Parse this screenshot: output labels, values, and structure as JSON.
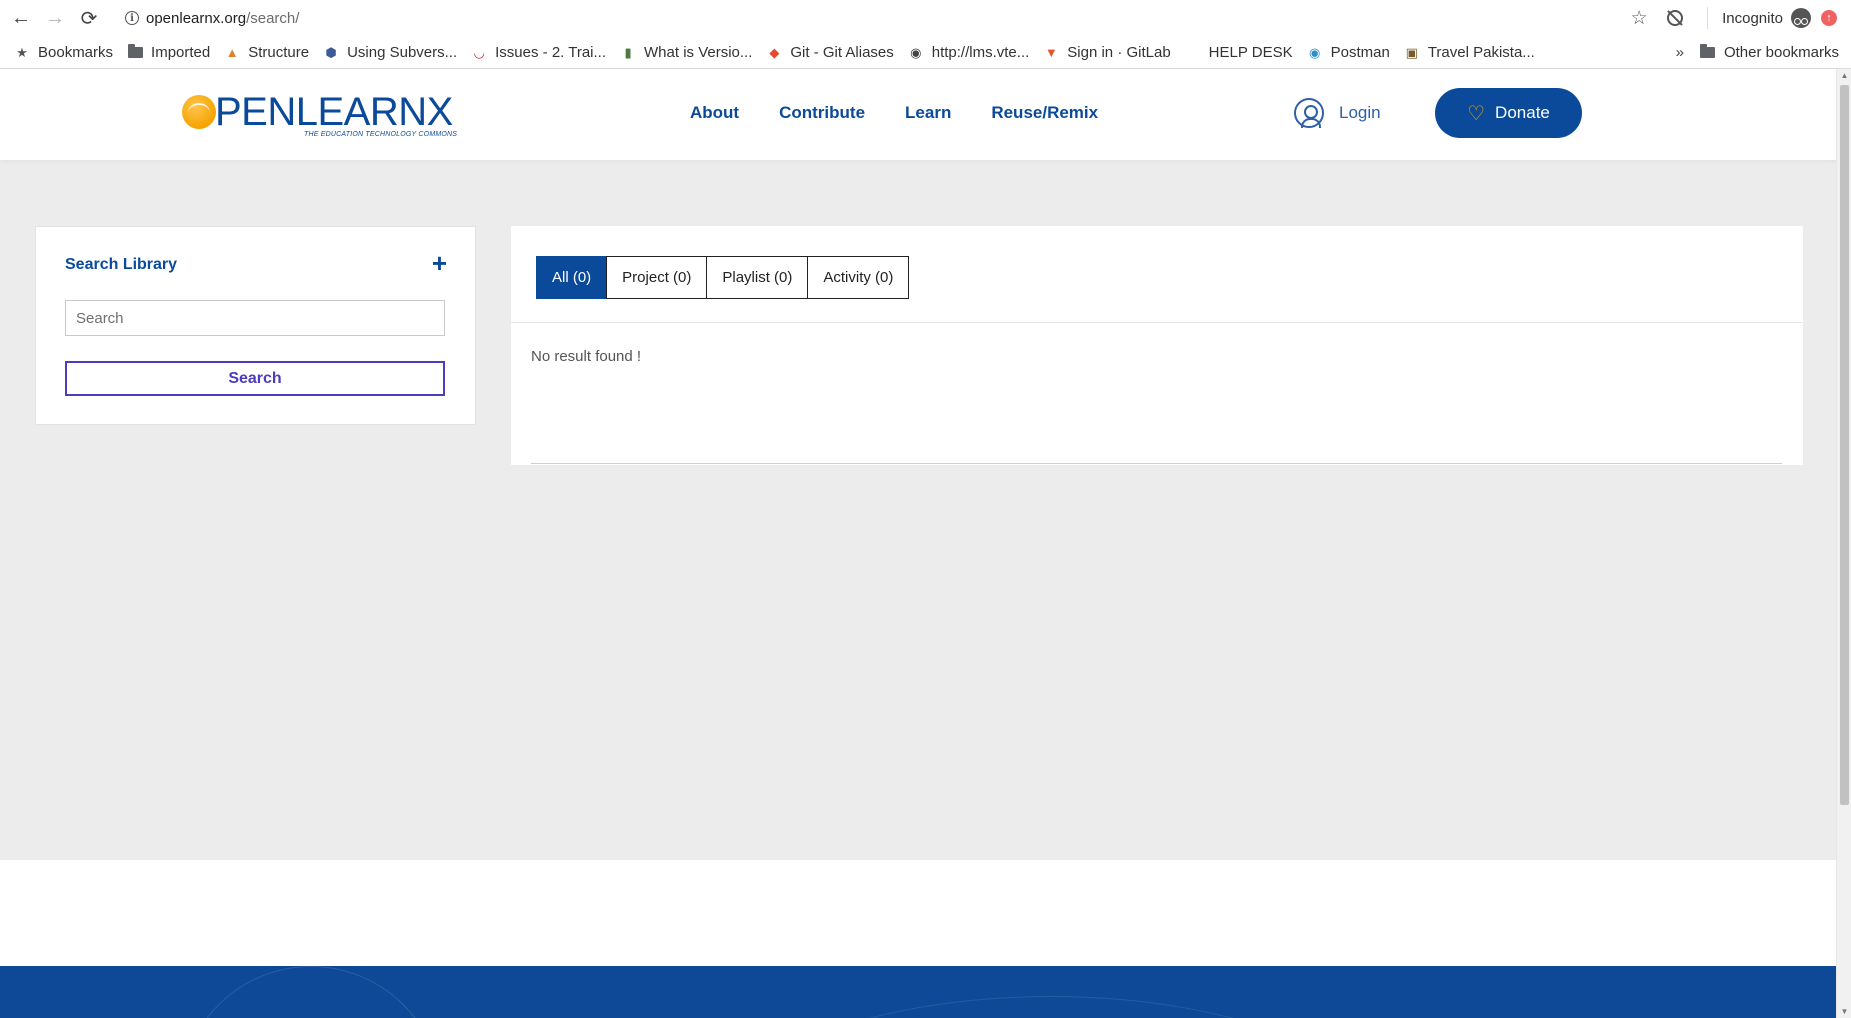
{
  "browser": {
    "url_domain": "openlearnx.org",
    "url_path": "/search/",
    "incognito_label": "Incognito",
    "bookmarks": [
      {
        "label": "Bookmarks",
        "icon": "star-icon"
      },
      {
        "label": "Imported",
        "icon": "folder-icon"
      },
      {
        "label": "Structure",
        "icon": "structure-icon"
      },
      {
        "label": "Using Subvers...",
        "icon": "cube-icon"
      },
      {
        "label": "Issues - 2. Trai...",
        "icon": "redmine-icon"
      },
      {
        "label": "What is Versio...",
        "icon": "book-icon"
      },
      {
        "label": "Git - Git Aliases",
        "icon": "git-icon"
      },
      {
        "label": "http://lms.vte...",
        "icon": "globe-icon"
      },
      {
        "label": "Sign in · GitLab",
        "icon": "gitlab-icon"
      },
      {
        "label": "HELP DESK",
        "icon": ""
      },
      {
        "label": "Postman",
        "icon": "globe-color-icon"
      },
      {
        "label": "Travel Pakista...",
        "icon": "travel-icon"
      }
    ],
    "more_bookmarks": "»",
    "other_bookmarks": "Other bookmarks"
  },
  "header": {
    "logo_text": "PENLEARNX",
    "logo_subtitle": "THE EDUCATION TECHNOLOGY COMMONS",
    "nav": [
      "About",
      "Contribute",
      "Learn",
      "Reuse/Remix"
    ],
    "login_label": "Login",
    "donate_label": "Donate"
  },
  "sidebar": {
    "title": "Search Library",
    "plus": "+",
    "search_placeholder": "Search",
    "search_value": "",
    "search_button": "Search"
  },
  "results": {
    "tabs": [
      {
        "label": "All (0)",
        "active": true
      },
      {
        "label": "Project (0)",
        "active": false
      },
      {
        "label": "Playlist (0)",
        "active": false
      },
      {
        "label": "Activity (0)",
        "active": false
      }
    ],
    "empty_message": "No result found !"
  },
  "colors": {
    "brand_blue": "#0b4a9b",
    "accent_orange": "#f5a300",
    "search_button_border": "#4c3cbf",
    "footer_blue": "#0d4996"
  }
}
